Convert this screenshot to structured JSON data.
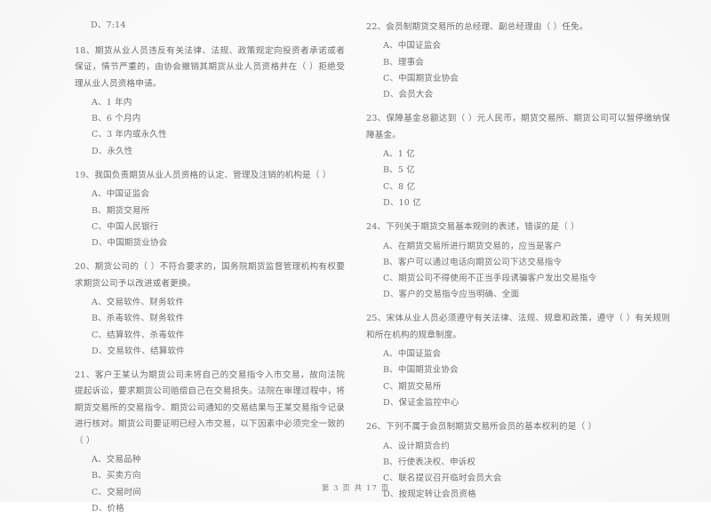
{
  "document": {
    "type": "exam-paper-scan",
    "language": "zh-CN",
    "page_footer": "第 3 页  共 17 页",
    "ink_color": "#6f6f6f",
    "paper_color": "#fefefe"
  },
  "left_column": {
    "orphan_option": "D、7:14",
    "questions": [
      {
        "number": "18",
        "stem": "18、期货从业人员违反有关法律、法规、政策规定向投资者承诺或者保证，情节严重的，由协会撤销其期货从业人员资格并在（      ）拒绝受理从业人员资格申请。",
        "options": [
          "A、1 年内",
          "B、6 个月内",
          "C、3 年内或永久性",
          "D、永久性"
        ]
      },
      {
        "number": "19",
        "stem": "19、我国负责期货从业人员资格的认定、管理及注销的机构是（      ）",
        "options": [
          "A、中国证监会",
          "B、期货交易所",
          "C、中国人民银行",
          "D、中国期货业协会"
        ]
      },
      {
        "number": "20",
        "stem": "20、期货公司的（      ）不符合要求的，国务院期货监督管理机构有权要求期货公司予以改进或者更换。",
        "options": [
          "A、交易软件、财务软件",
          "B、杀毒软件、财务软件",
          "C、结算软件、杀毒软件",
          "D、交易软件、结算软件"
        ]
      },
      {
        "number": "21",
        "stem": "21、客户王某认为期货公司未将自己的交易指令入市交易，故向法院提起诉讼，要求期货公司赔偿自己在交易损失。法院在审理过程中，将期货交易所的交易指令、期货公司通知的交易结果与王某交易指令记录进行核对。期货公司要证明已经入市交易，以下因素中必须完全一致的（      ）",
        "options": [
          "A、交易品种",
          "B、买卖方向",
          "C、交易时间",
          "D、价格"
        ]
      }
    ]
  },
  "right_column": {
    "questions": [
      {
        "number": "22",
        "stem": "22、会员制期货交易所的总经理、副总经理由（      ）任免。",
        "options": [
          "A、中国证监会",
          "B、理事会",
          "C、中国期货业协会",
          "D、会员大会"
        ]
      },
      {
        "number": "23",
        "stem": "23、保障基金总额达到（      ）元人民币，期货交易所、期货公司可以暂停缴纳保障基金。",
        "options": [
          "A、1 亿",
          "B、5 亿",
          "C、8 亿",
          "D、10 亿"
        ]
      },
      {
        "number": "24",
        "stem": "24、下列关于期货交易基本规则的表述，错误的是（      ）",
        "options": [
          "A、在期货交易所进行期货交易的，应当是客户",
          "B、客户可以通过电话向期货公司下达交易指令",
          "C、期货公司不得使用不正当手段诱骗客户发出交易指令",
          "D、客户的交易指令应当明确、全面"
        ]
      },
      {
        "number": "25",
        "stem": "25、宋体从业人员必须遵守有关法律、法规、规章和政策，遵守（      ）有关规则和所在机构的规章制度。",
        "options": [
          "A、中国证监会",
          "B、中国期货业协会",
          "C、期货交易所",
          "D、保证金监控中心"
        ]
      },
      {
        "number": "26",
        "stem": "26、下列不属于会员制期货交易所会员的基本权利的是（      ）",
        "options": [
          "A、设计期货合约",
          "B、行使表决权、申诉权",
          "C、联名提议召开临时会员大会",
          "D、按规定转让会员资格"
        ]
      }
    ]
  }
}
